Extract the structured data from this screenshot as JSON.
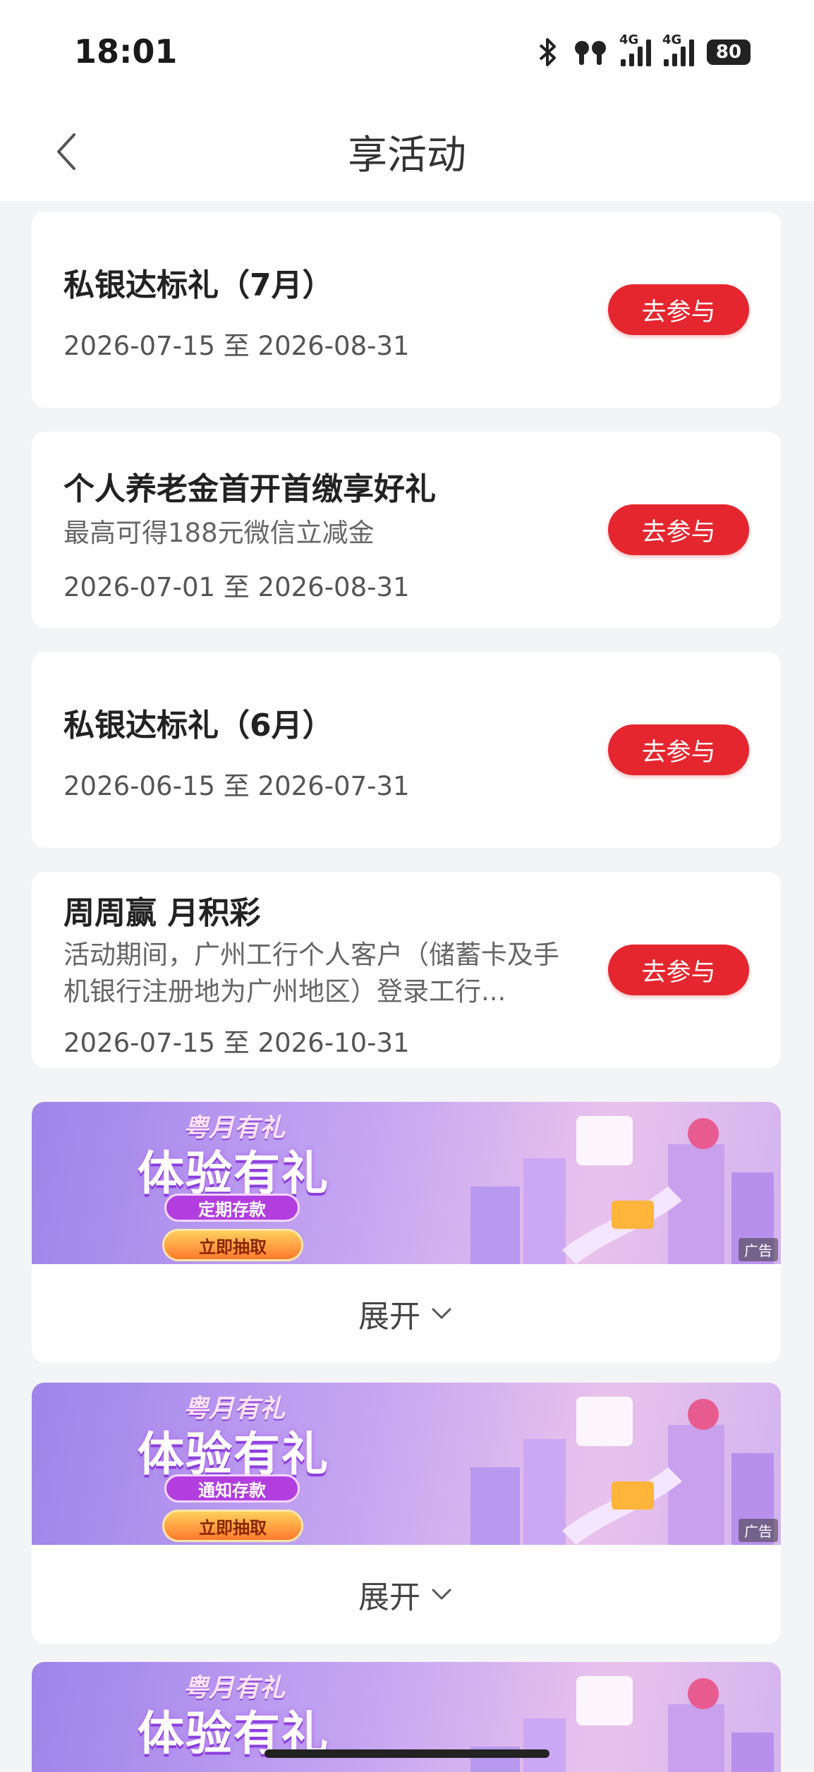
{
  "status_bar": {
    "time": "18:01",
    "net1": "4G",
    "net2": "4G",
    "battery": "80"
  },
  "header": {
    "title": "享活动",
    "back_icon": "chevron-left-icon"
  },
  "activities": [
    {
      "title": "私银达标礼（7月）",
      "desc": "",
      "date": "2026-07-15 至 2026-08-31",
      "button": "去参与"
    },
    {
      "title": "个人养老金首开首缴享好礼",
      "desc": "最高可得188元微信立减金",
      "date": "2026-07-01 至 2026-08-31",
      "button": "去参与"
    },
    {
      "title": "私银达标礼（6月）",
      "desc": "",
      "date": "2026-06-15 至 2026-07-31",
      "button": "去参与"
    },
    {
      "title": "周周赢 月积彩",
      "desc": "活动期间，广州工行个人客户（储蓄卡及手机银行注册地为广州地区）登录工行...",
      "date": "2026-07-15 至 2026-10-31",
      "button": "去参与"
    }
  ],
  "promos": [
    {
      "top": "粤月有礼",
      "main": "体验有礼",
      "tag": "定期存款",
      "cta": "立即抽取",
      "ad": "广告",
      "expand": "展开"
    },
    {
      "top": "粤月有礼",
      "main": "体验有礼",
      "tag": "通知存款",
      "cta": "立即抽取",
      "ad": "广告",
      "expand": "展开"
    },
    {
      "top": "粤月有礼",
      "main": "体验有礼"
    }
  ],
  "colors": {
    "accent": "#e6262f",
    "background": "#f3f4f6",
    "banner": "#b898ef"
  }
}
